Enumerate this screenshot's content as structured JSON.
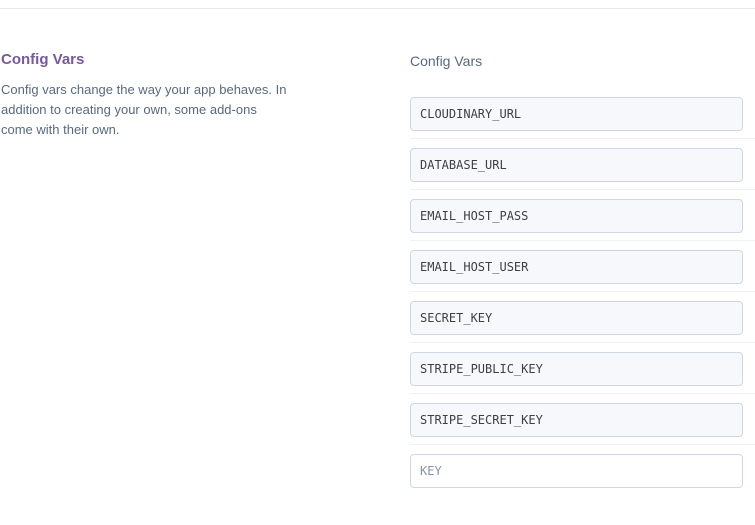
{
  "info": {
    "title": "Config Vars",
    "description": "Config vars change the way your app behaves. In addition to creating your own, some add-ons come with their own."
  },
  "config_vars": {
    "heading": "Config Vars",
    "keys": [
      "CLOUDINARY_URL",
      "DATABASE_URL",
      "EMAIL_HOST_PASS",
      "EMAIL_HOST_USER",
      "SECRET_KEY",
      "STRIPE_PUBLIC_KEY",
      "STRIPE_SECRET_KEY"
    ],
    "new_key_placeholder": "KEY"
  }
}
